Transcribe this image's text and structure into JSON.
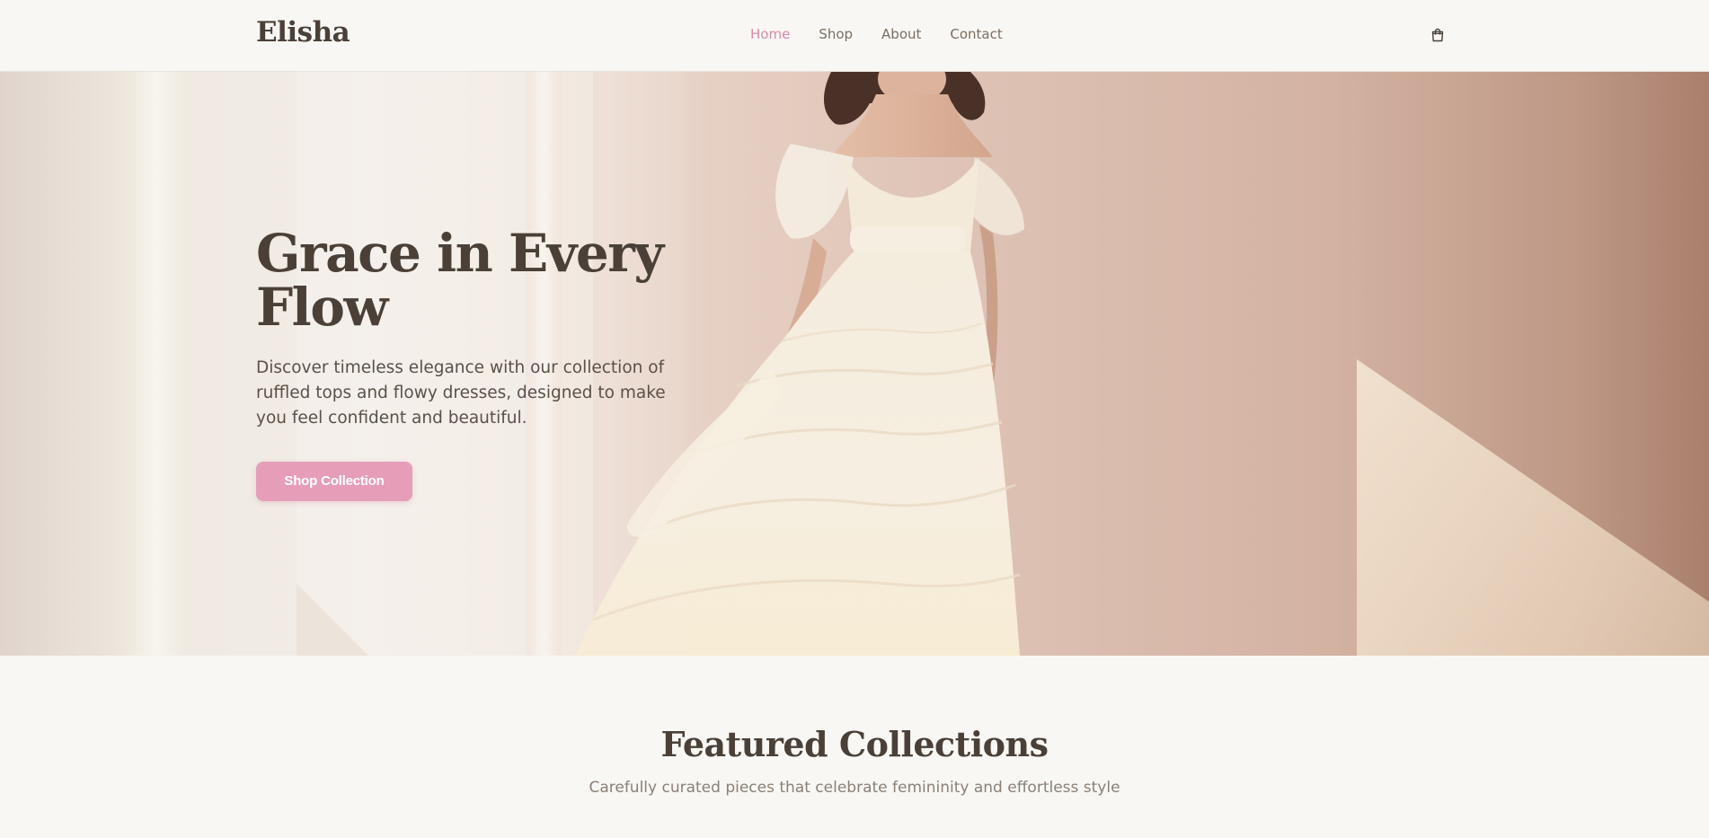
{
  "header": {
    "logo": "Elisha",
    "nav": [
      {
        "label": "Home",
        "active": true
      },
      {
        "label": "Shop",
        "active": false
      },
      {
        "label": "About",
        "active": false
      },
      {
        "label": "Contact",
        "active": false
      }
    ],
    "cart_icon": "shopping-bag-icon"
  },
  "hero": {
    "title_line1": "Grace in Every",
    "title_line2": "Flow",
    "subtitle": "Discover timeless elegance with our collection of ruffled tops and flowy dresses, designed to make you feel confident and beautiful.",
    "cta_label": "Shop Collection"
  },
  "featured": {
    "title": "Featured Collections",
    "subtitle": "Carefully curated pieces that celebrate femininity and effortless style"
  },
  "colors": {
    "accent": "#e69eb8",
    "nav_active": "#d98aa7",
    "text_dark": "#4a4038",
    "background": "#f9f7f3"
  }
}
